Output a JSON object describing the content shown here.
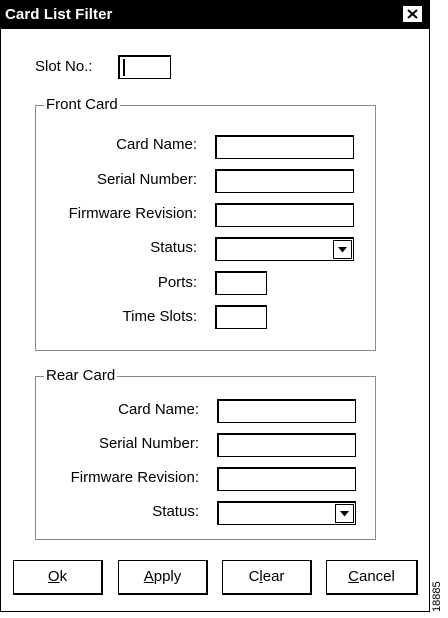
{
  "window": {
    "title": "Card List Filter",
    "close_icon": "close-x-icon"
  },
  "slot": {
    "label": "Slot No.:",
    "value": ""
  },
  "front_card": {
    "group_label": "Front Card",
    "card_name_label": "Card Name:",
    "card_name_value": "",
    "serial_number_label": "Serial Number:",
    "serial_number_value": "",
    "firmware_revision_label": "Firmware Revision:",
    "firmware_revision_value": "",
    "status_label": "Status:",
    "status_value": "",
    "ports_label": "Ports:",
    "ports_value": "",
    "time_slots_label": "Time Slots:",
    "time_slots_value": ""
  },
  "rear_card": {
    "group_label": "Rear Card",
    "card_name_label": "Card Name:",
    "card_name_value": "",
    "serial_number_label": "Serial Number:",
    "serial_number_value": "",
    "firmware_revision_label": "Firmware Revision:",
    "firmware_revision_value": "",
    "status_label": "Status:",
    "status_value": ""
  },
  "buttons": {
    "ok": {
      "mnemonic": "O",
      "rest": "k"
    },
    "apply": {
      "mnemonic": "A",
      "rest": "pply"
    },
    "clear": {
      "pre": "C",
      "mnemonic": "l",
      "rest": "ear"
    },
    "cancel": {
      "mnemonic": "C",
      "rest": "ancel"
    }
  },
  "figure_id": "18885",
  "icons": {
    "dropdown": "dropdown-arrow-icon",
    "close": "close-x-icon"
  }
}
